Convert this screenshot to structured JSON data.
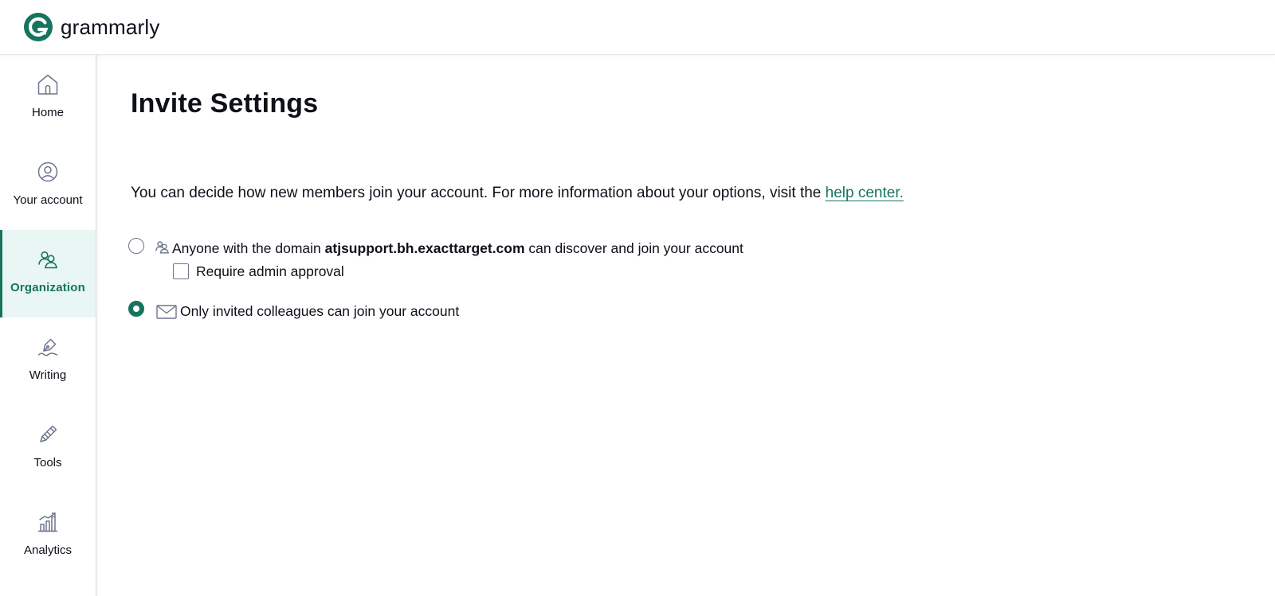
{
  "brand": {
    "name": "grammarly",
    "accent": "#15745e"
  },
  "sidebar": {
    "items": [
      {
        "label": "Home",
        "icon": "home-icon"
      },
      {
        "label": "Your account",
        "icon": "user-icon"
      },
      {
        "label": "Organization",
        "icon": "team-icon",
        "active": true
      },
      {
        "label": "Writing",
        "icon": "pen-icon"
      },
      {
        "label": "Tools",
        "icon": "pencil-icon"
      },
      {
        "label": "Analytics",
        "icon": "bar-chart-icon"
      }
    ]
  },
  "main": {
    "title": "Invite Settings",
    "intro_text": "You can decide how new members join your account. For more information about your options, visit the ",
    "help_link": "help center.",
    "options": {
      "domain": {
        "prefix": "Anyone with the domain ",
        "domain": "atjsupport.bh.exacttarget.com",
        "suffix": " can discover and join your account",
        "selected": false
      },
      "require_approval": {
        "label": "Require admin approval",
        "checked": false
      },
      "invited": {
        "label": "Only invited colleagues can join your account",
        "selected": true
      }
    }
  }
}
